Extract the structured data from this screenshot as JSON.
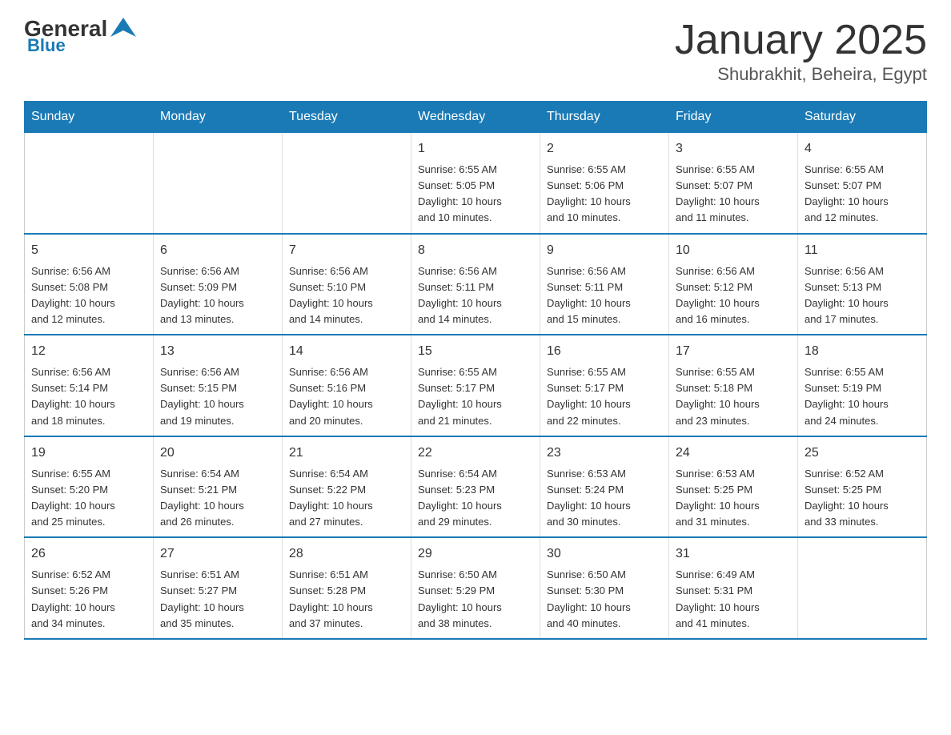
{
  "header": {
    "logo_general": "General",
    "logo_blue": "Blue",
    "title": "January 2025",
    "subtitle": "Shubrakhit, Beheira, Egypt"
  },
  "calendar": {
    "days_of_week": [
      "Sunday",
      "Monday",
      "Tuesday",
      "Wednesday",
      "Thursday",
      "Friday",
      "Saturday"
    ],
    "weeks": [
      [
        {
          "day": "",
          "info": ""
        },
        {
          "day": "",
          "info": ""
        },
        {
          "day": "",
          "info": ""
        },
        {
          "day": "1",
          "info": "Sunrise: 6:55 AM\nSunset: 5:05 PM\nDaylight: 10 hours\nand 10 minutes."
        },
        {
          "day": "2",
          "info": "Sunrise: 6:55 AM\nSunset: 5:06 PM\nDaylight: 10 hours\nand 10 minutes."
        },
        {
          "day": "3",
          "info": "Sunrise: 6:55 AM\nSunset: 5:07 PM\nDaylight: 10 hours\nand 11 minutes."
        },
        {
          "day": "4",
          "info": "Sunrise: 6:55 AM\nSunset: 5:07 PM\nDaylight: 10 hours\nand 12 minutes."
        }
      ],
      [
        {
          "day": "5",
          "info": "Sunrise: 6:56 AM\nSunset: 5:08 PM\nDaylight: 10 hours\nand 12 minutes."
        },
        {
          "day": "6",
          "info": "Sunrise: 6:56 AM\nSunset: 5:09 PM\nDaylight: 10 hours\nand 13 minutes."
        },
        {
          "day": "7",
          "info": "Sunrise: 6:56 AM\nSunset: 5:10 PM\nDaylight: 10 hours\nand 14 minutes."
        },
        {
          "day": "8",
          "info": "Sunrise: 6:56 AM\nSunset: 5:11 PM\nDaylight: 10 hours\nand 14 minutes."
        },
        {
          "day": "9",
          "info": "Sunrise: 6:56 AM\nSunset: 5:11 PM\nDaylight: 10 hours\nand 15 minutes."
        },
        {
          "day": "10",
          "info": "Sunrise: 6:56 AM\nSunset: 5:12 PM\nDaylight: 10 hours\nand 16 minutes."
        },
        {
          "day": "11",
          "info": "Sunrise: 6:56 AM\nSunset: 5:13 PM\nDaylight: 10 hours\nand 17 minutes."
        }
      ],
      [
        {
          "day": "12",
          "info": "Sunrise: 6:56 AM\nSunset: 5:14 PM\nDaylight: 10 hours\nand 18 minutes."
        },
        {
          "day": "13",
          "info": "Sunrise: 6:56 AM\nSunset: 5:15 PM\nDaylight: 10 hours\nand 19 minutes."
        },
        {
          "day": "14",
          "info": "Sunrise: 6:56 AM\nSunset: 5:16 PM\nDaylight: 10 hours\nand 20 minutes."
        },
        {
          "day": "15",
          "info": "Sunrise: 6:55 AM\nSunset: 5:17 PM\nDaylight: 10 hours\nand 21 minutes."
        },
        {
          "day": "16",
          "info": "Sunrise: 6:55 AM\nSunset: 5:17 PM\nDaylight: 10 hours\nand 22 minutes."
        },
        {
          "day": "17",
          "info": "Sunrise: 6:55 AM\nSunset: 5:18 PM\nDaylight: 10 hours\nand 23 minutes."
        },
        {
          "day": "18",
          "info": "Sunrise: 6:55 AM\nSunset: 5:19 PM\nDaylight: 10 hours\nand 24 minutes."
        }
      ],
      [
        {
          "day": "19",
          "info": "Sunrise: 6:55 AM\nSunset: 5:20 PM\nDaylight: 10 hours\nand 25 minutes."
        },
        {
          "day": "20",
          "info": "Sunrise: 6:54 AM\nSunset: 5:21 PM\nDaylight: 10 hours\nand 26 minutes."
        },
        {
          "day": "21",
          "info": "Sunrise: 6:54 AM\nSunset: 5:22 PM\nDaylight: 10 hours\nand 27 minutes."
        },
        {
          "day": "22",
          "info": "Sunrise: 6:54 AM\nSunset: 5:23 PM\nDaylight: 10 hours\nand 29 minutes."
        },
        {
          "day": "23",
          "info": "Sunrise: 6:53 AM\nSunset: 5:24 PM\nDaylight: 10 hours\nand 30 minutes."
        },
        {
          "day": "24",
          "info": "Sunrise: 6:53 AM\nSunset: 5:25 PM\nDaylight: 10 hours\nand 31 minutes."
        },
        {
          "day": "25",
          "info": "Sunrise: 6:52 AM\nSunset: 5:25 PM\nDaylight: 10 hours\nand 33 minutes."
        }
      ],
      [
        {
          "day": "26",
          "info": "Sunrise: 6:52 AM\nSunset: 5:26 PM\nDaylight: 10 hours\nand 34 minutes."
        },
        {
          "day": "27",
          "info": "Sunrise: 6:51 AM\nSunset: 5:27 PM\nDaylight: 10 hours\nand 35 minutes."
        },
        {
          "day": "28",
          "info": "Sunrise: 6:51 AM\nSunset: 5:28 PM\nDaylight: 10 hours\nand 37 minutes."
        },
        {
          "day": "29",
          "info": "Sunrise: 6:50 AM\nSunset: 5:29 PM\nDaylight: 10 hours\nand 38 minutes."
        },
        {
          "day": "30",
          "info": "Sunrise: 6:50 AM\nSunset: 5:30 PM\nDaylight: 10 hours\nand 40 minutes."
        },
        {
          "day": "31",
          "info": "Sunrise: 6:49 AM\nSunset: 5:31 PM\nDaylight: 10 hours\nand 41 minutes."
        },
        {
          "day": "",
          "info": ""
        }
      ]
    ]
  }
}
